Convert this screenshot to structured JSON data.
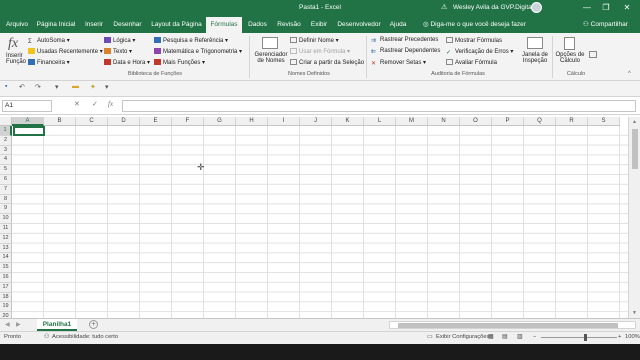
{
  "window": {
    "title": "Pasta1 - Excel",
    "user": "Wesley Avila da GVP.Digital",
    "warning_icon": "warning-icon",
    "minimize": "—",
    "restore": "❐",
    "close": "✕"
  },
  "tabs": [
    "Arquivo",
    "Página Inicial",
    "Inserir",
    "Desenhar",
    "Layout da Página",
    "Fórmulas",
    "Dados",
    "Revisão",
    "Exibir",
    "Desenvolvedor",
    "Ajuda"
  ],
  "active_tab": "Fórmulas",
  "tell_me": "Diga-me o que você deseja fazer",
  "share": "Compartilhar",
  "ribbon": {
    "insert_function": [
      "Inserir",
      "Função"
    ],
    "library": {
      "autosum": "AutoSoma",
      "recent": "Usadas Recentemente",
      "financial": "Financeira",
      "logical": "Lógica",
      "text": "Texto",
      "datetime": "Data e Hora",
      "lookup": "Pesquisa e Referência",
      "math": "Matemática e Trigonometria",
      "more": "Mais Funções",
      "label": "Biblioteca de Funções"
    },
    "names": {
      "manager": [
        "Gerenciador",
        "de Nomes"
      ],
      "define": "Definir Nome",
      "use_in_formula": "Usar em Fórmula",
      "create_from_selection": "Criar a partir da Seleção",
      "label": "Nomes Definidos"
    },
    "audit": {
      "trace_precedents": "Rastrear Precedentes",
      "trace_dependents": "Rastrear Dependentes",
      "remove_arrows": "Remover Setas",
      "show_formulas": "Mostrar Fórmulas",
      "error_check": "Verificação de Erros",
      "evaluate": "Avaliar Fórmula",
      "watch": [
        "Janela de",
        "Inspeção"
      ],
      "label": "Auditoria de Fórmulas"
    },
    "calc": {
      "options": [
        "Opções de",
        "Cálculo"
      ],
      "label": "Cálculo"
    }
  },
  "formula_bar": {
    "name_box": "A1",
    "fx": "fx",
    "value": ""
  },
  "grid": {
    "columns": [
      "A",
      "B",
      "C",
      "D",
      "E",
      "F",
      "G",
      "H",
      "I",
      "J",
      "K",
      "L",
      "M",
      "N",
      "O",
      "P",
      "Q",
      "R",
      "S"
    ],
    "rows": [
      "1",
      "2",
      "3",
      "4",
      "5",
      "6",
      "7",
      "8",
      "9",
      "10",
      "11",
      "12",
      "13",
      "14",
      "15",
      "16",
      "17",
      "18",
      "19",
      "20"
    ],
    "active_cell": "A1"
  },
  "sheets": [
    "Planilha1"
  ],
  "status": {
    "ready": "Pronto",
    "accessibility": "Acessibilidade: tudo certo",
    "display_settings": "Exibir Configurações",
    "zoom": "100%"
  },
  "colors": {
    "brand": "#217346",
    "ribbon_bg": "#f3f3f3"
  }
}
